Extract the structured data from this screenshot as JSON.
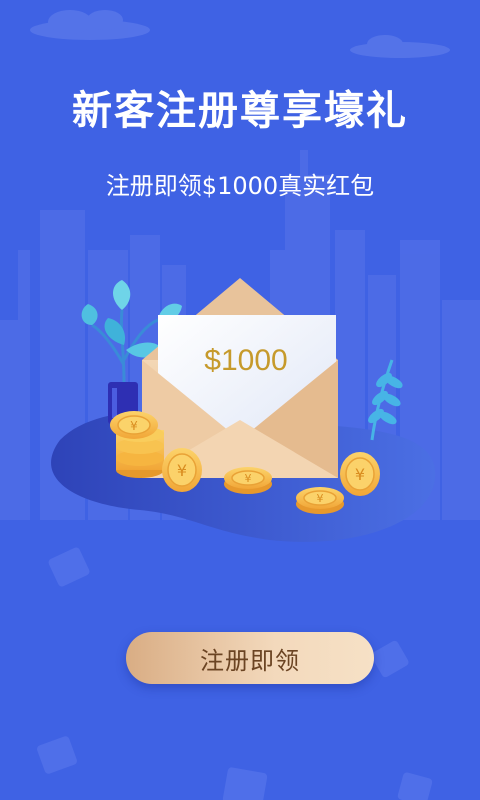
{
  "promo": {
    "title": "新客注册尊享壕礼",
    "subtitle": "注册即领$1000真实红包"
  },
  "envelope": {
    "amount": "$1000",
    "amount_color": "#c69a2b"
  },
  "cta": {
    "label": "注册即领"
  },
  "colors": {
    "background": "#3f62e4",
    "cta_gradient_start": "#d9ad84",
    "cta_gradient_end": "#f6e1c6"
  },
  "icons": [
    "city-skyline-icon",
    "cloud-icon",
    "plant-icon",
    "envelope-icon",
    "coin-icon",
    "wallet-icon"
  ]
}
